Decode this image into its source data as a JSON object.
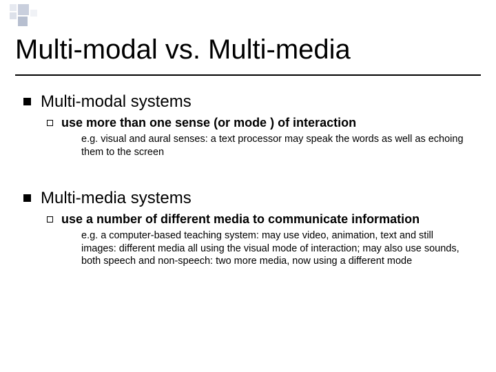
{
  "title": "Multi-modal vs. Multi-media",
  "sections": [
    {
      "heading": "Multi-modal systems",
      "sub": "use more than one sense (or mode ) of interaction",
      "example": "e.g. visual and aural senses: a text processor may speak the words as well as echoing them to the screen"
    },
    {
      "heading": "Multi-media systems",
      "sub": "use a number of different media to communicate information",
      "example": "e.g. a computer-based teaching system: may use video, animation, text and still images: different media all using the visual mode of interaction; may also use sounds, both speech and non-speech: two more media, now using a different mode"
    }
  ]
}
